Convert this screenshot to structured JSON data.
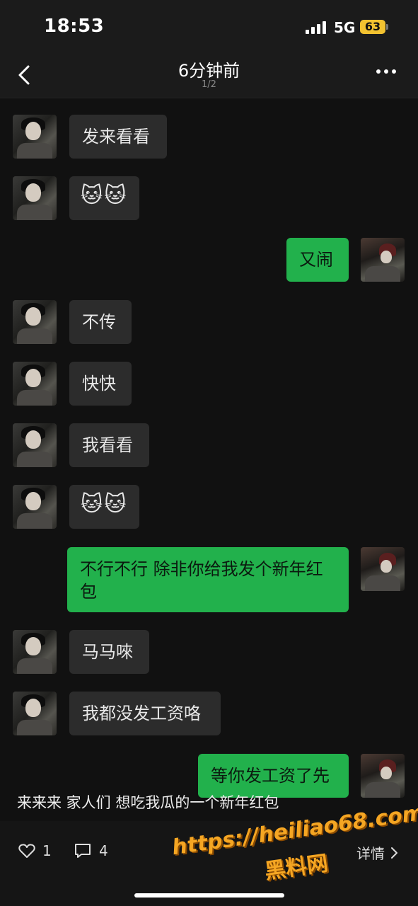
{
  "status": {
    "time": "18:53",
    "network": "5G",
    "battery": "63"
  },
  "nav": {
    "title": "6分钟前",
    "subtitle": "1/2"
  },
  "messages": [
    {
      "side": "left",
      "text": "发来看看"
    },
    {
      "side": "left",
      "text": "🐱🐱",
      "type": "emoji"
    },
    {
      "side": "right",
      "text": "又闹"
    },
    {
      "side": "left",
      "text": "不传"
    },
    {
      "side": "left",
      "text": "快快"
    },
    {
      "side": "left",
      "text": "我看看"
    },
    {
      "side": "left",
      "text": "🐱🐱",
      "type": "emoji"
    },
    {
      "side": "right",
      "text": "不行不行 除非你给我发个新年红包"
    },
    {
      "side": "left",
      "text": "马马唻"
    },
    {
      "side": "left",
      "text": "我都没发工资咯"
    },
    {
      "side": "right",
      "text": "等你发工资了先"
    }
  ],
  "caption": "来来来 家人们 想吃我瓜的一个新年红包",
  "footer": {
    "likes": "1",
    "comments": "4",
    "details": "详情"
  },
  "watermark": {
    "url": "https://heiliao68.com",
    "name": "黑料网"
  }
}
